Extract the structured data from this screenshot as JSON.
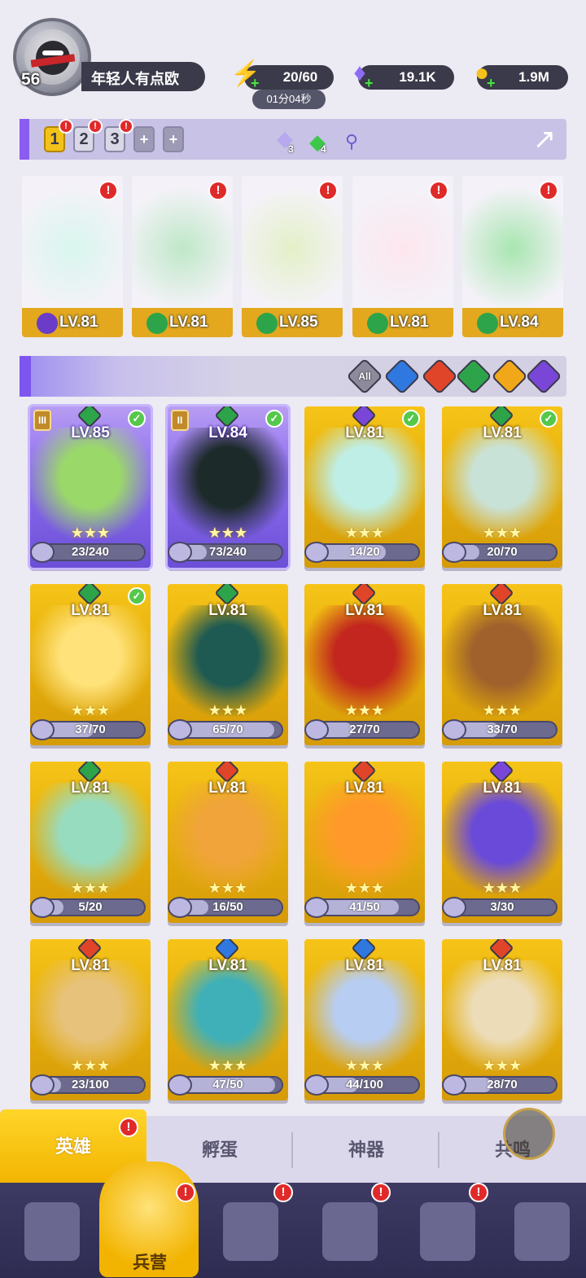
{
  "header": {
    "player_level": "56",
    "player_name": "年轻人有点欧",
    "energy": "20/60",
    "energy_timer": "01分04秒",
    "diamonds": "19.1K",
    "gold": "1.9M"
  },
  "team_bar": {
    "slots": [
      "1",
      "2",
      "3"
    ],
    "add_symbol": "+",
    "alert_symbol": "!",
    "gem_purple_count": "3",
    "gem_green_count": "4"
  },
  "team_heroes": [
    {
      "level": "LV.81",
      "element_color": "#6a3cc8"
    },
    {
      "level": "LV.81",
      "element_color": "#2da44a"
    },
    {
      "level": "LV.85",
      "element_color": "#2da44a"
    },
    {
      "level": "LV.81",
      "element_color": "#2da44a"
    },
    {
      "level": "LV.84",
      "element_color": "#2da44a"
    }
  ],
  "filters": [
    {
      "label": "All",
      "color": "#8d8a9c"
    },
    {
      "label": "",
      "color": "#2f78e0"
    },
    {
      "label": "",
      "color": "#e0452a"
    },
    {
      "label": "",
      "color": "#2da44a"
    },
    {
      "label": "",
      "color": "#f0a81a"
    },
    {
      "label": "",
      "color": "#7a46d8"
    }
  ],
  "heroes": [
    {
      "level": "LV.85",
      "shards": "23/240",
      "fill": 0.1,
      "element": "#2da44a",
      "check": true,
      "rank": "III",
      "purple": true,
      "art": "#9bd86a"
    },
    {
      "level": "LV.84",
      "shards": "73/240",
      "fill": 0.3,
      "element": "#2da44a",
      "check": true,
      "rank": "II",
      "purple": true,
      "art": "#1d2a2a"
    },
    {
      "level": "LV.81",
      "shards": "14/20",
      "fill": 0.7,
      "element": "#7a46d8",
      "check": true,
      "rank": "",
      "purple": false,
      "art": "#bfeee6"
    },
    {
      "level": "LV.81",
      "shards": "20/70",
      "fill": 0.29,
      "element": "#2da44a",
      "check": true,
      "rank": "",
      "purple": false,
      "art": "#c9e2d8"
    },
    {
      "level": "LV.81",
      "shards": "37/70",
      "fill": 0.53,
      "element": "#2da44a",
      "check": true,
      "rank": "",
      "purple": false,
      "art": "#ffe27a"
    },
    {
      "level": "LV.81",
      "shards": "65/70",
      "fill": 0.93,
      "element": "#2da44a",
      "check": false,
      "rank": "",
      "purple": false,
      "art": "#1f5a52"
    },
    {
      "level": "LV.81",
      "shards": "27/70",
      "fill": 0.39,
      "element": "#e0452a",
      "check": false,
      "rank": "",
      "purple": false,
      "art": "#c2261e"
    },
    {
      "level": "LV.81",
      "shards": "33/70",
      "fill": 0.47,
      "element": "#e0452a",
      "check": false,
      "rank": "",
      "purple": false,
      "art": "#a0612c"
    },
    {
      "level": "LV.81",
      "shards": "5/20",
      "fill": 0.25,
      "element": "#2da44a",
      "check": false,
      "rank": "",
      "purple": false,
      "art": "#98dcc0"
    },
    {
      "level": "LV.81",
      "shards": "16/50",
      "fill": 0.32,
      "element": "#e0452a",
      "check": false,
      "rank": "",
      "purple": false,
      "art": "#f0a43a"
    },
    {
      "level": "LV.81",
      "shards": "41/50",
      "fill": 0.82,
      "element": "#e0452a",
      "check": false,
      "rank": "",
      "purple": false,
      "art": "#ff9a2a"
    },
    {
      "level": "LV.81",
      "shards": "3/30",
      "fill": 0.1,
      "element": "#7a46d8",
      "check": false,
      "rank": "",
      "purple": false,
      "art": "#6a4ad8"
    },
    {
      "level": "LV.81",
      "shards": "23/100",
      "fill": 0.23,
      "element": "#e0452a",
      "check": false,
      "rank": "",
      "purple": false,
      "art": "#e7c27a"
    },
    {
      "level": "LV.81",
      "shards": "47/50",
      "fill": 0.94,
      "element": "#2f78e0",
      "check": false,
      "rank": "",
      "purple": false,
      "art": "#3fb0b8"
    },
    {
      "level": "LV.81",
      "shards": "44/100",
      "fill": 0.44,
      "element": "#2f78e0",
      "check": false,
      "rank": "",
      "purple": false,
      "art": "#b8cdf2"
    },
    {
      "level": "LV.81",
      "shards": "28/70",
      "fill": 0.4,
      "element": "#e0452a",
      "check": false,
      "rank": "",
      "purple": false,
      "art": "#ecdcb8"
    }
  ],
  "sub_tabs": [
    "英雄",
    "孵蛋",
    "神器",
    "共鸣"
  ],
  "nav": {
    "active_label": "兵营"
  }
}
